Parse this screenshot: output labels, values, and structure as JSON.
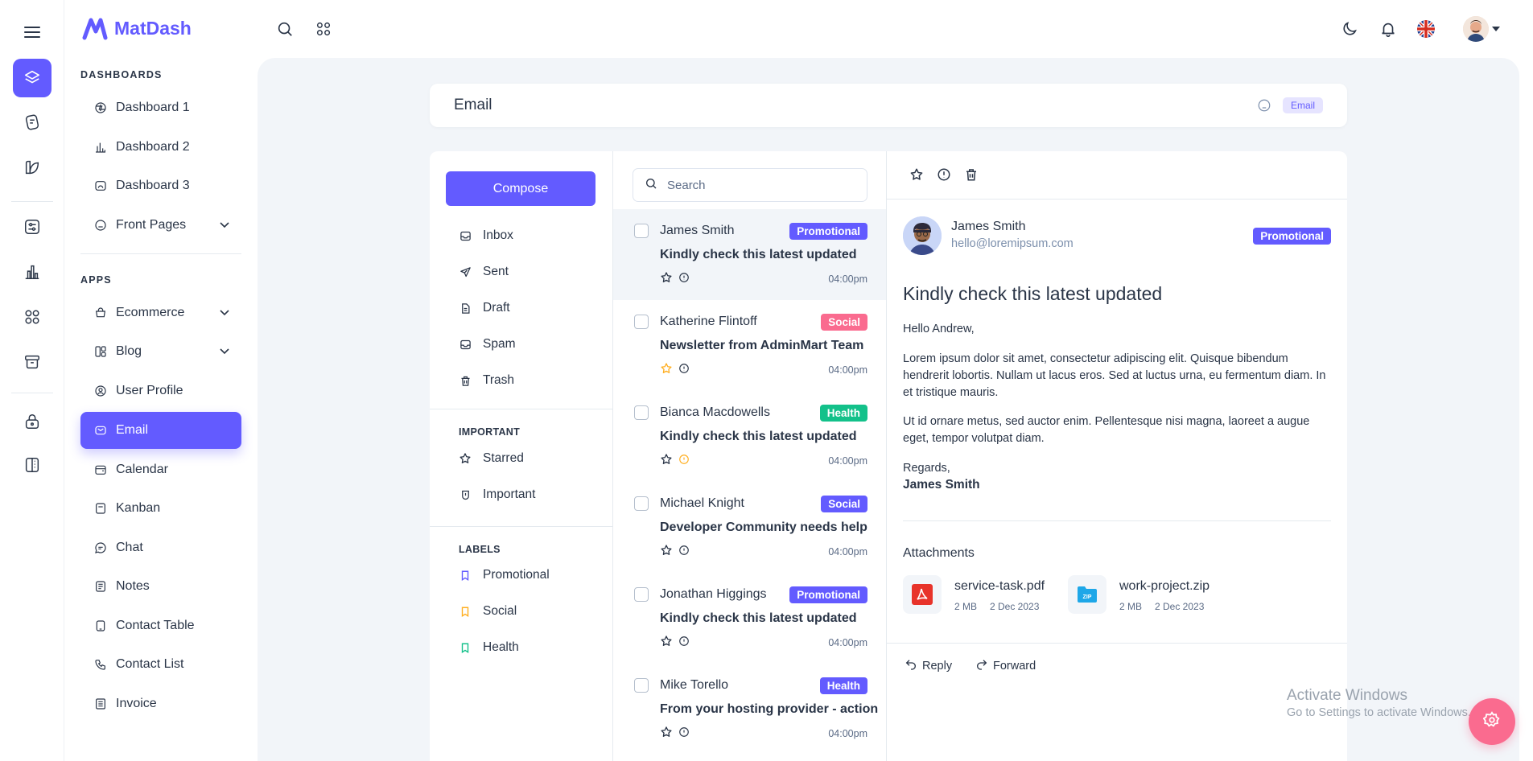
{
  "app": {
    "name": "MatDash"
  },
  "colors": {
    "primary": "#635bff",
    "promotional": "#635bff",
    "social_pink": "#fa6b8f",
    "health_green": "#13c18a",
    "social_purple": "#635bff"
  },
  "sidebar": {
    "dashboards_title": "DASHBOARDS",
    "apps_title": "APPS",
    "dashboards": [
      {
        "label": "Dashboard 1",
        "icon": "aperture-icon"
      },
      {
        "label": "Dashboard 2",
        "icon": "chart-icon"
      },
      {
        "label": "Dashboard 3",
        "icon": "dashboard-icon"
      },
      {
        "label": "Front Pages",
        "icon": "home-icon"
      }
    ],
    "apps": [
      {
        "label": "Ecommerce",
        "icon": "basket-icon"
      },
      {
        "label": "Blog",
        "icon": "blog-icon"
      },
      {
        "label": "User Profile",
        "icon": "user-icon"
      },
      {
        "label": "Email",
        "icon": "mail-icon"
      },
      {
        "label": "Calendar",
        "icon": "calendar-icon"
      },
      {
        "label": "Kanban",
        "icon": "kanban-icon"
      },
      {
        "label": "Chat",
        "icon": "chat-icon"
      },
      {
        "label": "Notes",
        "icon": "notes-icon"
      },
      {
        "label": "Contact Table",
        "icon": "phone-icon"
      },
      {
        "label": "Contact List",
        "icon": "phone-call-icon"
      },
      {
        "label": "Invoice",
        "icon": "invoice-icon"
      }
    ]
  },
  "page": {
    "title": "Email",
    "breadcrumb": "Email"
  },
  "folders": {
    "compose": "Compose",
    "items": [
      {
        "label": "Inbox",
        "icon": "inbox-icon"
      },
      {
        "label": "Sent",
        "icon": "send-icon"
      },
      {
        "label": "Draft",
        "icon": "file-icon"
      },
      {
        "label": "Spam",
        "icon": "spam-icon"
      },
      {
        "label": "Trash",
        "icon": "trash-icon"
      }
    ],
    "important_title": "IMPORTANT",
    "important": [
      {
        "label": "Starred",
        "icon": "star-icon"
      },
      {
        "label": "Important",
        "icon": "important-icon"
      }
    ],
    "labels_title": "LABELS",
    "labels": [
      {
        "label": "Promotional",
        "color": "#635bff"
      },
      {
        "label": "Social",
        "color": "#ffae1f"
      },
      {
        "label": "Health",
        "color": "#13c18a"
      }
    ]
  },
  "search": {
    "placeholder": "Search"
  },
  "mails": [
    {
      "sender": "James Smith",
      "badge": "Promotional",
      "badge_color": "#635bff",
      "subject": "Kindly check this latest updated",
      "time": "04:00pm",
      "starred": false,
      "important": false,
      "selected": true
    },
    {
      "sender": "Katherine Flintoff",
      "badge": "Social",
      "badge_color": "#fa6b8f",
      "subject": "Newsletter from AdminMart Team",
      "time": "04:00pm",
      "starred": true,
      "important": false,
      "selected": false
    },
    {
      "sender": "Bianca Macdowells",
      "badge": "Health",
      "badge_color": "#13c18a",
      "subject": "Kindly check this latest updated",
      "time": "04:00pm",
      "starred": false,
      "important": true,
      "selected": false
    },
    {
      "sender": "Michael Knight",
      "badge": "Social",
      "badge_color": "#635bff",
      "subject": "Developer Community needs help",
      "time": "04:00pm",
      "starred": false,
      "important": false,
      "selected": false
    },
    {
      "sender": "Jonathan Higgings",
      "badge": "Promotional",
      "badge_color": "#635bff",
      "subject": "Kindly check this latest updated",
      "time": "04:00pm",
      "starred": false,
      "important": false,
      "selected": false
    },
    {
      "sender": "Mike Torello",
      "badge": "Health",
      "badge_color": "#635bff",
      "subject": "From your hosting provider - action",
      "time": "04:00pm",
      "starred": false,
      "important": false,
      "selected": false
    }
  ],
  "reader": {
    "from_name": "James Smith",
    "from_email": "hello@loremipsum.com",
    "badge": "Promotional",
    "subject": "Kindly check this latest updated",
    "greeting": "Hello Andrew,",
    "para1": "Lorem ipsum dolor sit amet, consectetur adipiscing elit. Quisque bibendum hendrerit lobortis. Nullam ut lacus eros. Sed at luctus urna, eu fermentum diam. In et tristique mauris.",
    "para2": "Ut id ornare metus, sed auctor enim. Pellentesque nisi magna, laoreet a augue eget, tempor volutpat diam.",
    "regards": "Regards,",
    "regards_name": "James Smith",
    "attachments_title": "Attachments",
    "attachments": [
      {
        "name": "service-task.pdf",
        "size": "2 MB",
        "date": "2 Dec 2023",
        "icon": "pdf-icon"
      },
      {
        "name": "work-project.zip",
        "size": "2 MB",
        "date": "2 Dec 2023",
        "icon": "zip-icon"
      }
    ],
    "reply": "Reply",
    "forward": "Forward"
  },
  "watermark": {
    "line1": "Activate Windows",
    "line2": "Go to Settings to activate Windows."
  }
}
